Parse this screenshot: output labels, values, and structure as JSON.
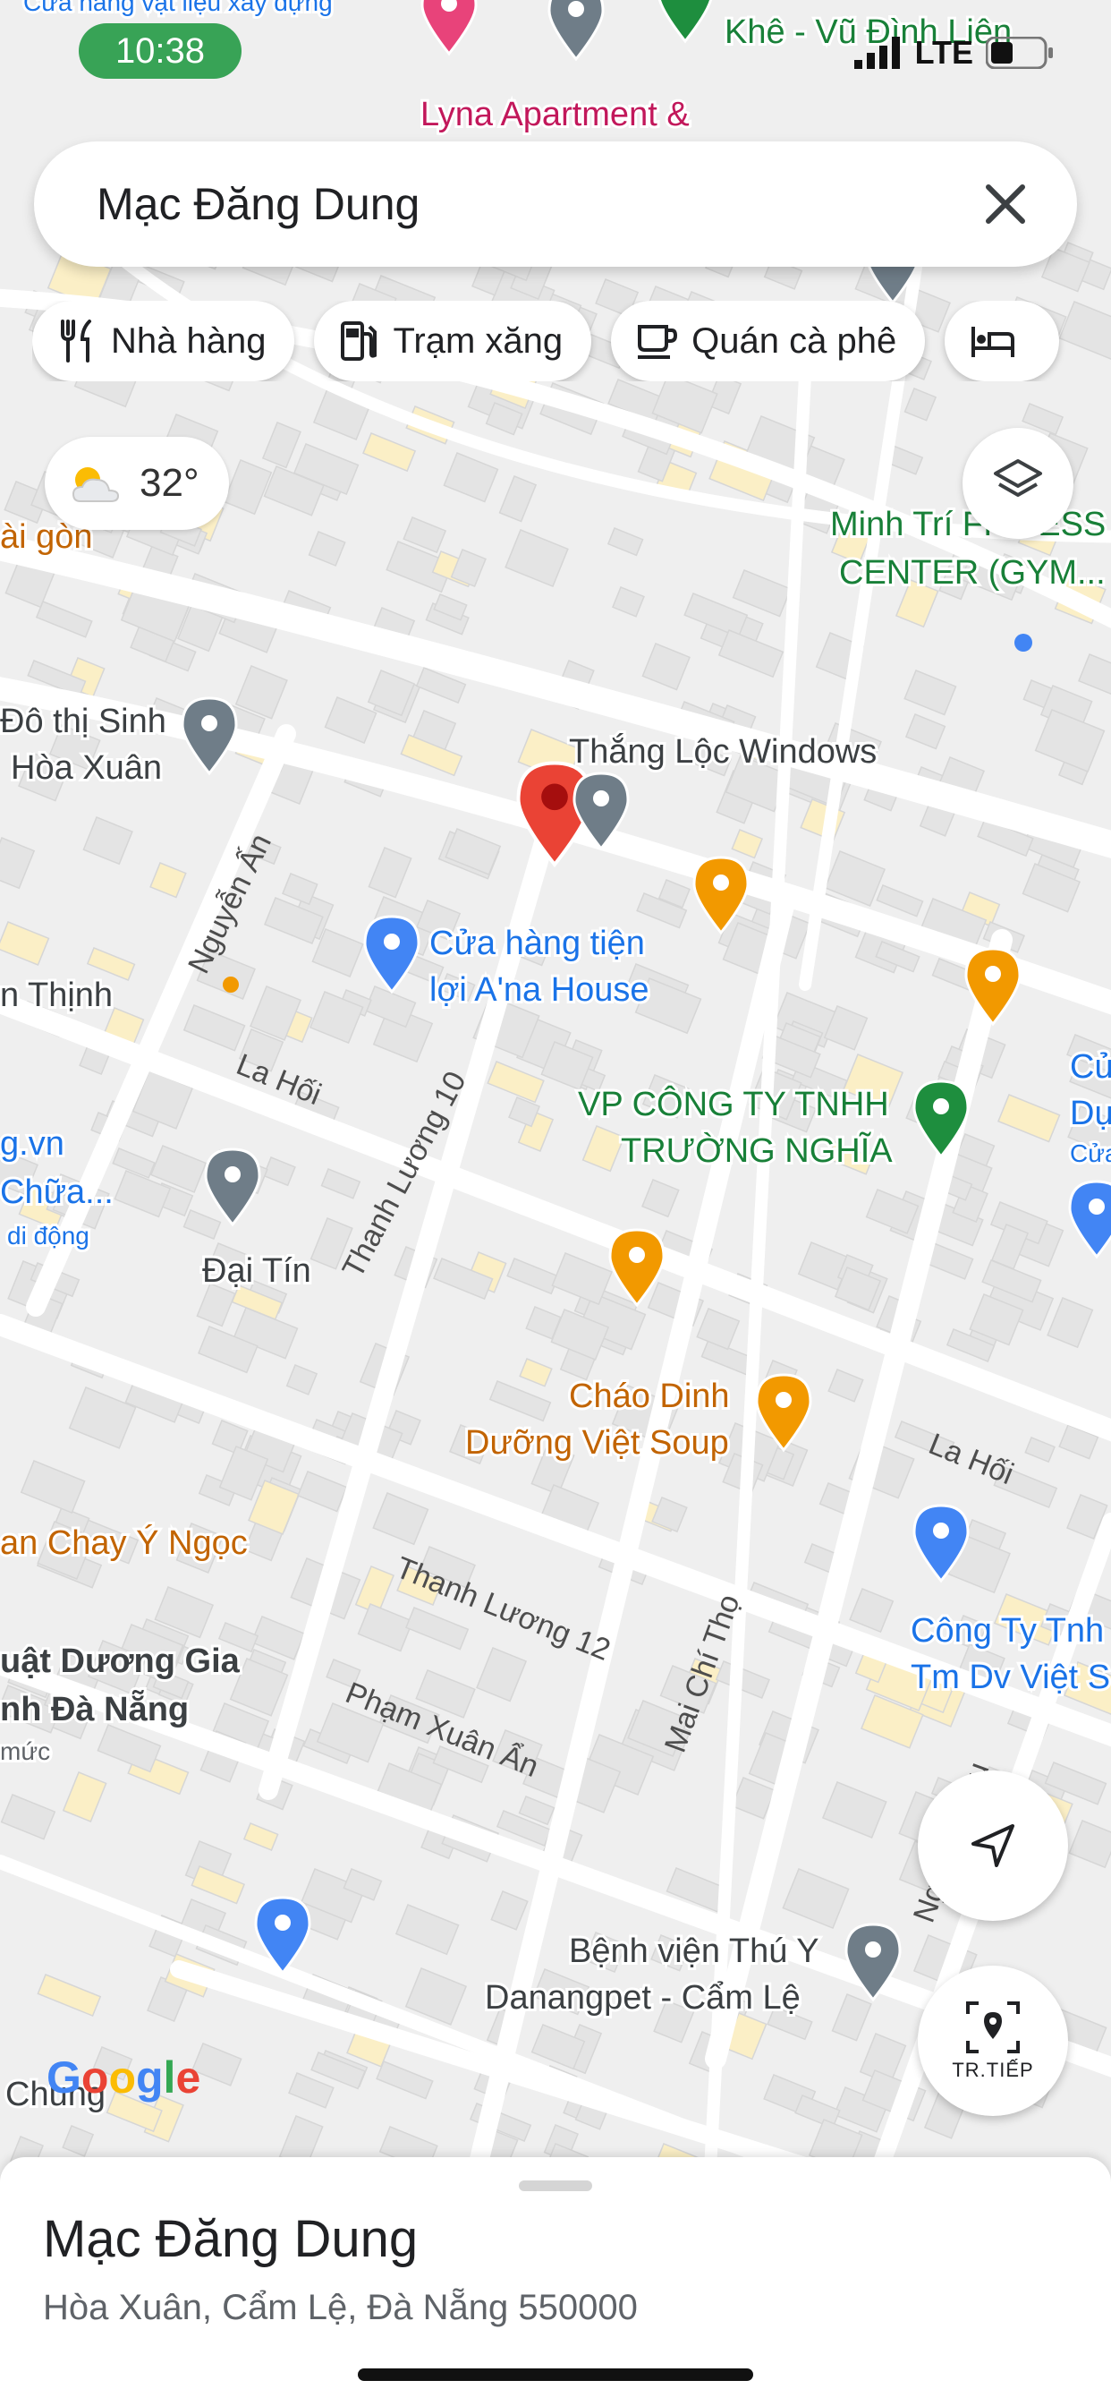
{
  "status": {
    "time": "10:38",
    "network": "LTE"
  },
  "search": {
    "query": "Mạc Đăng Dung"
  },
  "chips": [
    {
      "label": "Nhà hàng",
      "icon": "fork-knife-icon"
    },
    {
      "label": "Trạm xăng",
      "icon": "gas-station-icon"
    },
    {
      "label": "Quán cà phê",
      "icon": "coffee-cup-icon"
    },
    {
      "label": "",
      "icon": "bed-icon"
    }
  ],
  "weather": {
    "temp": "32°"
  },
  "map": {
    "labels": [
      {
        "text": "Cửa hàng vật liệu xây dựng",
        "color": "#1a73e8"
      },
      {
        "text": "Khê - Vũ Đình Liên",
        "color": "#188038"
      },
      {
        "text": "Lyna Apartment &",
        "color": "#c2185b"
      },
      {
        "text": "Minh Trí FITNESS",
        "color": "#188038"
      },
      {
        "text": "CENTER (GYM...",
        "color": "#188038"
      },
      {
        "text": "ài gòn",
        "color": "#c26401"
      },
      {
        "text": "Đô thị Sinh",
        "color": "#3c4043"
      },
      {
        "text": "Hòa Xuân",
        "color": "#3c4043"
      },
      {
        "text": "Thắng Lộc Windows",
        "color": "#3c4043"
      },
      {
        "text": "Cửa hàng tiện",
        "color": "#1a73e8"
      },
      {
        "text": "lợi A'na House",
        "color": "#1a73e8"
      },
      {
        "text": "n Thịnh",
        "color": "#3c4043"
      },
      {
        "text": "VP CÔNG TY TNHH",
        "color": "#188038"
      },
      {
        "text": "TRƯỜNG NGHĨA",
        "color": "#188038"
      },
      {
        "text": "g.vn",
        "color": "#1a73e8"
      },
      {
        "text": "Chữa...",
        "color": "#1a73e8"
      },
      {
        "text": "di động",
        "color": "#1a73e8"
      },
      {
        "text": "Đại Tín",
        "color": "#3c4043"
      },
      {
        "text": "Cháo Dinh",
        "color": "#c26401"
      },
      {
        "text": "Dưỡng Việt Soup",
        "color": "#c26401"
      },
      {
        "text": "an Chay Ý Ngọc",
        "color": "#c26401"
      },
      {
        "text": "uật Dương Gia",
        "color": "#3c4043"
      },
      {
        "text": "nh Đà Nẵng",
        "color": "#3c4043"
      },
      {
        "text": "mức",
        "color": "#5f6368"
      },
      {
        "text": "Công Ty Tnh",
        "color": "#1a73e8"
      },
      {
        "text": "Tm Dv Việt S",
        "color": "#1a73e8"
      },
      {
        "text": "Bệnh viện Thú Y",
        "color": "#3c4043"
      },
      {
        "text": "Danangpet - Cẩm Lệ",
        "color": "#3c4043"
      },
      {
        "text": "Chung",
        "color": "#3c4043"
      },
      {
        "text": "Cử",
        "color": "#1a73e8"
      },
      {
        "text": "Dụ",
        "color": "#1a73e8"
      },
      {
        "text": "Cửa",
        "color": "#1a73e8"
      }
    ],
    "streets": [
      "Nguyễn Ấn",
      "La Hối",
      "Thanh Lương 10",
      "La Hối",
      "Thanh Lương 12",
      "Phạm Xuân Ẩn",
      "Mai Chí Thọ",
      "Nguyễn Sáu"
    ],
    "logo": "Google"
  },
  "controls": {
    "nav_label": "TR.TIẾP"
  },
  "place": {
    "name": "Mạc Đăng Dung",
    "address": "Hòa Xuân, Cẩm Lệ, Đà Nẵng 550000"
  },
  "colors": {
    "road": "#ffffff",
    "block": "#e4e4e4",
    "land": "#efefef",
    "pin_red": "#ea4335",
    "pin_gray": "#6f7d88",
    "poi_orange": "#f29900",
    "poi_green": "#1e8e3e",
    "poi_blue": "#4285f4"
  }
}
